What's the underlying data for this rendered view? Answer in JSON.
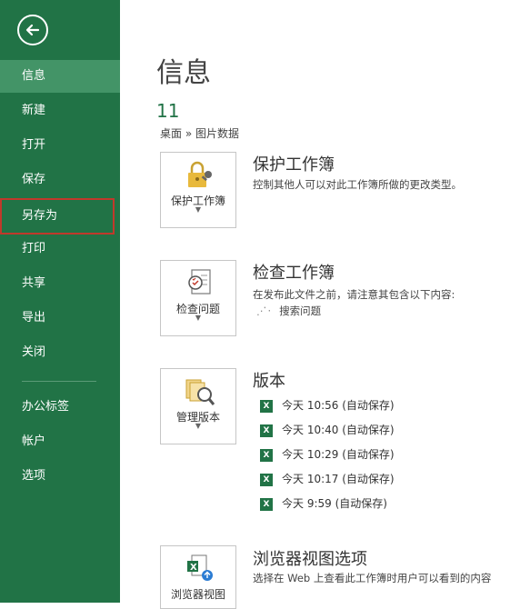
{
  "sidebar": {
    "items": [
      {
        "label": "信息"
      },
      {
        "label": "新建"
      },
      {
        "label": "打开"
      },
      {
        "label": "保存"
      },
      {
        "label": "另存为"
      },
      {
        "label": "打印"
      },
      {
        "label": "共享"
      },
      {
        "label": "导出"
      },
      {
        "label": "关闭"
      },
      {
        "label": "办公标签"
      },
      {
        "label": "帐户"
      },
      {
        "label": "选项"
      }
    ]
  },
  "main": {
    "title": "信息",
    "file_name": "11",
    "file_path": "桌面 » 图片数据",
    "protect": {
      "tile_label": "保护工作簿",
      "title": "保护工作簿",
      "desc": "控制其他人可以对此工作簿所做的更改类型。"
    },
    "inspect": {
      "tile_label": "检查问题",
      "title": "检查工作簿",
      "desc": "在发布此文件之前，请注意其包含以下内容:",
      "searching": "搜索问题"
    },
    "versions": {
      "tile_label": "管理版本",
      "title": "版本",
      "items": [
        {
          "label": "今天 10:56 (自动保存)"
        },
        {
          "label": "今天 10:40 (自动保存)"
        },
        {
          "label": "今天 10:29 (自动保存)"
        },
        {
          "label": "今天 10:17 (自动保存)"
        },
        {
          "label": "今天 9:59 (自动保存)"
        }
      ]
    },
    "browser": {
      "tile_label": "浏览器视图",
      "title": "浏览器视图选项",
      "desc": "选择在 Web 上查看此工作簿时用户可以看到的内容"
    }
  },
  "colors": {
    "accent": "#217346",
    "active": "#439467",
    "highlight": "#c0392b"
  }
}
